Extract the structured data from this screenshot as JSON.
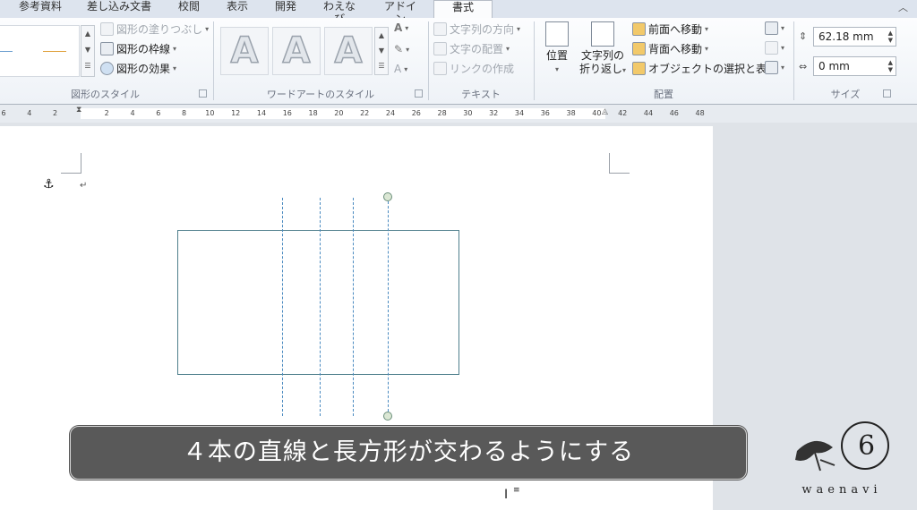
{
  "tabs": [
    "参考資料",
    "差し込み文書",
    "校閲",
    "表示",
    "開発",
    "わえなび",
    "アドイン",
    "書式"
  ],
  "active_tab": "書式",
  "ribbon": {
    "shape_styles": {
      "label": "図形のスタイル",
      "fill": "図形の塗りつぶし",
      "outline": "図形の枠線",
      "effects": "図形の効果"
    },
    "wordart_styles": {
      "label": "ワードアートのスタイル",
      "sample_letter": "A"
    },
    "text": {
      "label": "テキスト",
      "direction": "文字列の方向",
      "align": "文字の配置",
      "link": "リンクの作成"
    },
    "arrange": {
      "label": "配置",
      "position": "位置",
      "wrap_line1": "文字列の",
      "wrap_line2": "折り返し",
      "bring_forward": "前面へ移動",
      "send_backward": "背面へ移動",
      "selection_pane": "オブジェクトの選択と表示"
    },
    "size": {
      "label": "サイズ",
      "height": "62.18 mm",
      "width": "0 mm"
    }
  },
  "ruler_numbers": [
    "6",
    "4",
    "2",
    "",
    "2",
    "4",
    "6",
    "8",
    "10",
    "12",
    "14",
    "16",
    "18",
    "20",
    "22",
    "24",
    "26",
    "28",
    "30",
    "32",
    "34",
    "36",
    "38",
    "40",
    "42",
    "44",
    "46",
    "48"
  ],
  "document": {
    "anchor_symbol": "⚓",
    "return_mark": "↵"
  },
  "caption": "４本の直線と長方形が交わるようにする",
  "logo_text": "waenavi",
  "colors": {
    "guide_line": "#4a8ac0",
    "rectangle_border": "#4f7f8c",
    "caption_bg": "#595959"
  }
}
